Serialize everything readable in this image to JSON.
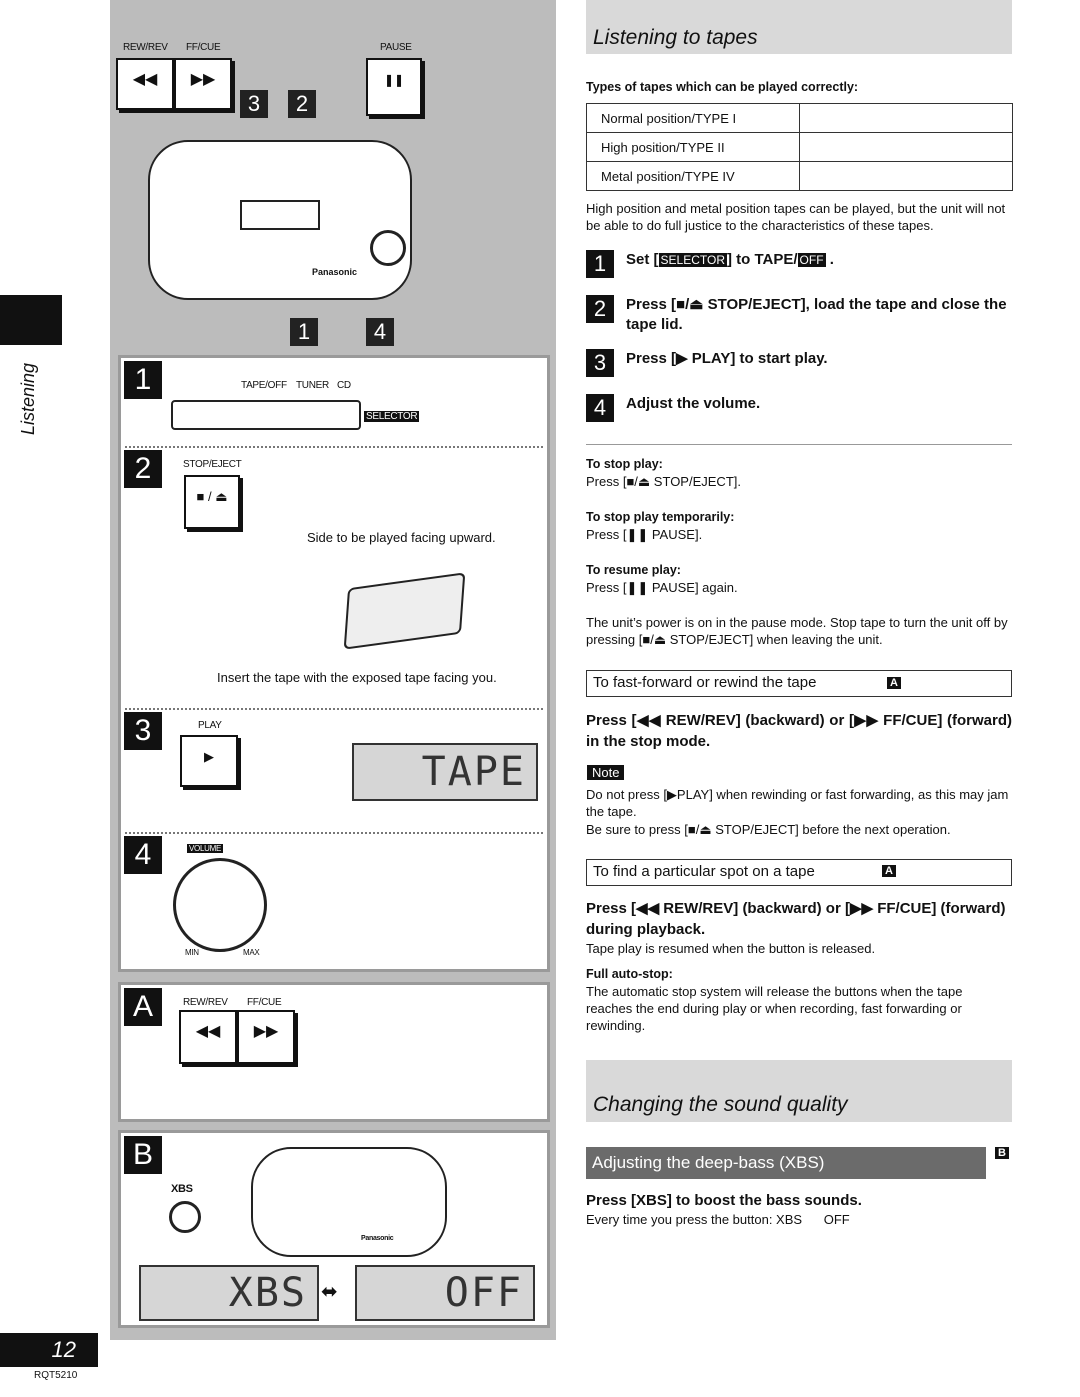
{
  "side": {
    "section_label": "Listening",
    "page_number": "12",
    "doc_code": "RQT5210"
  },
  "illustration": {
    "top": {
      "rew_label": "REW/REV",
      "ff_label": "FF/CUE",
      "pause_label": "PAUSE",
      "callouts": [
        "3",
        "2",
        "1",
        "4"
      ],
      "brand": "Panasonic"
    },
    "step1": {
      "num": "1",
      "tape_off": "TAPE/OFF",
      "tuner": "TUNER",
      "cd": "CD",
      "selector": "SELECTOR"
    },
    "step2": {
      "num": "2",
      "stop_eject": "STOP/EJECT",
      "caption_side": "Side to be played facing upward.",
      "caption_insert": "Insert the tape with the exposed tape facing you."
    },
    "step3": {
      "num": "3",
      "play": "PLAY",
      "display": "TAPE"
    },
    "step4": {
      "num": "4",
      "volume": "VOLUME",
      "min": "MIN",
      "max": "MAX"
    },
    "a": {
      "letter": "A",
      "rew_label": "REW/REV",
      "ff_label": "FF/CUE"
    },
    "b": {
      "letter": "B",
      "xbs": "XBS",
      "display_on": "XBS",
      "display_off": "OFF",
      "brand": "Panasonic"
    }
  },
  "main": {
    "title": "Listening to tapes",
    "types_heading": "Types of tapes which can be played correctly:",
    "tape_types": [
      "Normal position/TYPE I",
      "High position/TYPE II",
      "Metal position/TYPE IV"
    ],
    "types_note": "High position and metal position tapes can be played, but the unit will not be able to do full justice to the characteristics of these tapes.",
    "steps": [
      {
        "num": "1",
        "pre": "Set [",
        "selector": "SELECTOR",
        "mid": "] to  TAPE/",
        "off": "OFF",
        "post": " ."
      },
      {
        "num": "2",
        "text": "Press [■/⏏ STOP/EJECT], load the tape and close the tape lid."
      },
      {
        "num": "3",
        "text": "Press [▶ PLAY] to start play."
      },
      {
        "num": "4",
        "text": "Adjust the volume."
      }
    ],
    "tips": [
      {
        "heading": "To stop play:",
        "text": "Press [■/⏏ STOP/EJECT]."
      },
      {
        "heading": "To stop play temporarily:",
        "text": "Press [❚❚ PAUSE]."
      },
      {
        "heading": "To resume play:",
        "text": "Press [❚❚ PAUSE] again."
      }
    ],
    "power_note": "The unit’s power is on in the pause mode. Stop tape to turn the unit off by pressing [■/⏏ STOP/EJECT] when leaving the unit.",
    "ff": {
      "heading": "To fast-forward or rewind the tape",
      "ref": "A",
      "instruction": "Press [◀◀ REW/REV] (backward) or [▶▶ FF/CUE] (forward) in the stop mode.",
      "note_label": "Note",
      "note1": "Do not press [▶PLAY] when rewinding or fast forwarding, as this may jam the tape.",
      "note2": "Be sure to press [■/⏏ STOP/EJECT] before the next operation."
    },
    "find": {
      "heading": "To find a particular spot on a tape",
      "ref": "A",
      "instruction": "Press [◀◀ REW/REV] (backward) or [▶▶ FF/CUE] (forward) during playback.",
      "text": "Tape play is resumed when the button is released.",
      "auto_heading": "Full auto-stop:",
      "auto_text": "The automatic stop system will release the buttons when the tape reaches the end during play or when recording, fast forwarding or rewinding."
    },
    "sound": {
      "title": "Changing the sound quality",
      "xbs_heading": "Adjusting the deep-bass (XBS)",
      "ref": "B",
      "instruction": "Press [XBS] to boost the bass sounds.",
      "text": "Every time you press the button: XBS      OFF"
    }
  }
}
